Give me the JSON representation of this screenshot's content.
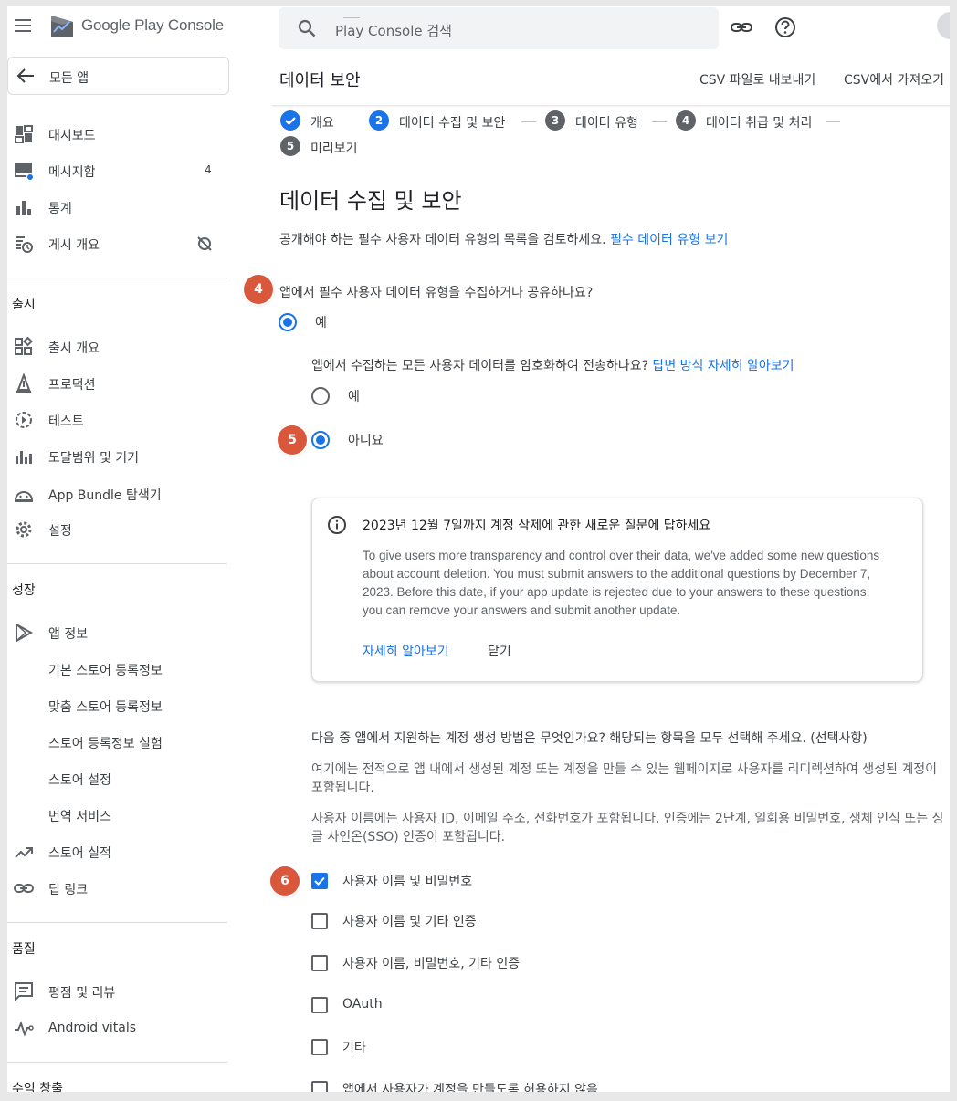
{
  "app": {
    "brand": "Google Play Console",
    "back_label": "모든 앱"
  },
  "search": {
    "placeholder": "Play Console 검색"
  },
  "nav": {
    "top": [
      {
        "label": "대시보드",
        "icon": "dashboard-icon"
      },
      {
        "label": "메시지함",
        "icon": "inbox-icon",
        "badge": "4"
      },
      {
        "label": "통계",
        "icon": "bar-chart-icon"
      },
      {
        "label": "게시 개요",
        "icon": "publishing-icon"
      }
    ],
    "release_section": "출시",
    "release": [
      {
        "label": "출시 개요",
        "icon": "release-overview-icon"
      },
      {
        "label": "프로덕션",
        "icon": "production-icon"
      },
      {
        "label": "테스트",
        "icon": "testing-icon"
      },
      {
        "label": "도달범위 및 기기",
        "icon": "reach-devices-icon"
      },
      {
        "label": "App Bundle 탐색기",
        "icon": "android-icon"
      },
      {
        "label": "설정",
        "icon": "gear-icon"
      }
    ],
    "growth_section": "성장",
    "growth_store_presence": "앱 정보",
    "growth_sub": [
      "기본 스토어 등록정보",
      "맞춤 스토어 등록정보",
      "스토어 등록정보 실험",
      "스토어 설정",
      "번역 서비스"
    ],
    "growth_more": [
      {
        "label": "스토어 실적",
        "icon": "trending-up-icon"
      },
      {
        "label": "딥 링크",
        "icon": "link-icon"
      }
    ],
    "quality_section": "품질",
    "quality": [
      {
        "label": "평점 및 리뷰",
        "icon": "reviews-icon"
      },
      {
        "label": "Android vitals",
        "icon": "vitals-icon"
      }
    ],
    "monetize_section": "수익 창출"
  },
  "header": {
    "title": "데이터 보안",
    "export_csv": "CSV 파일로 내보내기",
    "import_csv": "CSV에서 가져오기"
  },
  "stepper": [
    {
      "num": "",
      "label": "개요",
      "state": "done"
    },
    {
      "num": "2",
      "label": "데이터 수집 및 보안",
      "state": "active"
    },
    {
      "num": "3",
      "label": "데이터 유형",
      "state": "todo"
    },
    {
      "num": "4",
      "label": "데이터 취급 및 처리",
      "state": "todo"
    },
    {
      "num": "5",
      "label": "미리보기",
      "state": "todo"
    }
  ],
  "main": {
    "heading": "데이터 수집 및 보안",
    "intro": "공개해야 하는 필수 사용자 데이터 유형의 목록을 검토하세요.",
    "intro_link": "필수 데이터 유형 보기",
    "q1": "앱에서 필수 사용자 데이터 유형을 수집하거나 공유하나요?",
    "q1_yes": "예",
    "q2": "앱에서 수집하는 모든 사용자 데이터를 암호화하여 전송하나요?",
    "q2_link": "답변 방식 자세히 알아보기",
    "q2_yes": "예",
    "q2_no": "아니요",
    "markers": [
      "4",
      "5",
      "6"
    ]
  },
  "info": {
    "title": "2023년 12월 7일까지 계정 삭제에 관한 새로운 질문에 답하세요",
    "body": "To give users more transparency and control over their data, we've added some new questions about account deletion. You must submit answers to the additional questions by December 7, 2023. Before this date, if your app update is rejected due to your answers to these questions, you can remove your answers and submit another update.",
    "learn_more": "자세히 알아보기",
    "dismiss": "닫기"
  },
  "account": {
    "question": "다음 중 앱에서 지원하는 계정 생성 방법은 무엇인가요? 해당되는 항목을 모두 선택해 주세요. (선택사항)",
    "desc1": "여기에는 전적으로 앱 내에서 생성된 계정 또는 계정을 만들 수 있는 웹페이지로 사용자를 리디렉션하여 생성된 계정이 포함됩니다.",
    "desc2": "사용자 이름에는 사용자 ID, 이메일 주소, 전화번호가 포함됩니다. 인증에는 2단계, 일회용 비밀번호, 생체 인식 또는 싱글 사인온(SSO) 인증이 포함됩니다.",
    "options": [
      {
        "label": "사용자 이름 및 비밀번호",
        "checked": true
      },
      {
        "label": "사용자 이름 및 기타 인증",
        "checked": false
      },
      {
        "label": "사용자 이름, 비밀번호, 기타 인증",
        "checked": false
      },
      {
        "label": "OAuth",
        "checked": false
      },
      {
        "label": "기타",
        "checked": false
      },
      {
        "label": "앱에서 사용자가 계정을 만들도록 허용하지 않음",
        "checked": false
      }
    ]
  },
  "colors": {
    "accent": "#1a73e8",
    "marker": "#d9573b",
    "step_todo": "#5f6368"
  }
}
